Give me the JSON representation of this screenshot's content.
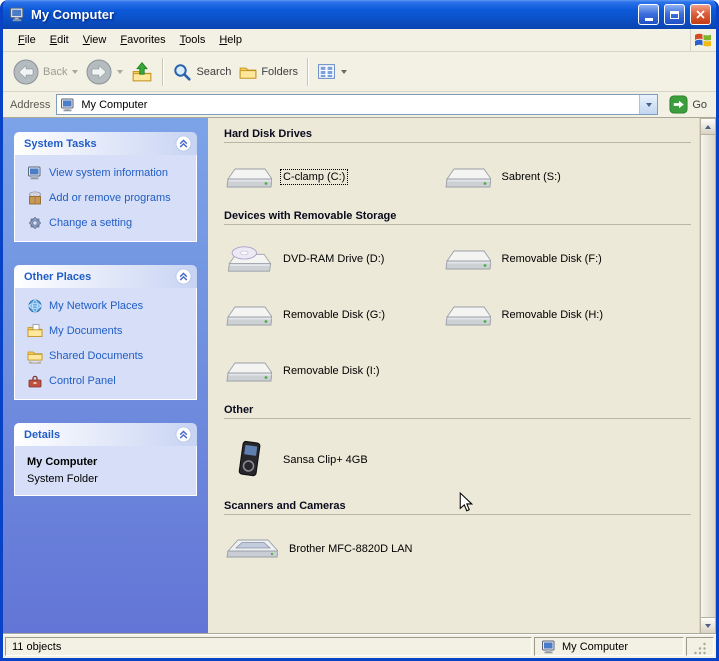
{
  "window": {
    "title": "My Computer"
  },
  "menu": {
    "items": [
      "File",
      "Edit",
      "View",
      "Favorites",
      "Tools",
      "Help"
    ]
  },
  "toolbar": {
    "back_label": "Back",
    "search_label": "Search",
    "folders_label": "Folders"
  },
  "address_bar": {
    "label": "Address",
    "value": "My Computer",
    "go_label": "Go"
  },
  "sidebar": {
    "system_tasks": {
      "title": "System Tasks",
      "items": [
        "View system information",
        "Add or remove programs",
        "Change a setting"
      ]
    },
    "other_places": {
      "title": "Other Places",
      "items": [
        "My Network Places",
        "My Documents",
        "Shared Documents",
        "Control Panel"
      ]
    },
    "details": {
      "title": "Details",
      "name": "My Computer",
      "type": "System Folder"
    }
  },
  "content": {
    "sections": [
      {
        "title": "Hard Disk Drives",
        "items": [
          {
            "label": "C-clamp (C:)"
          },
          {
            "label": "Sabrent (S:)"
          }
        ]
      },
      {
        "title": "Devices with Removable Storage",
        "items": [
          {
            "label": "DVD-RAM Drive (D:)"
          },
          {
            "label": "Removable Disk (F:)"
          },
          {
            "label": "Removable Disk (G:)"
          },
          {
            "label": "Removable Disk (H:)"
          },
          {
            "label": "Removable Disk (I:)"
          }
        ]
      },
      {
        "title": "Other",
        "items": [
          {
            "label": "Sansa Clip+ 4GB"
          }
        ]
      },
      {
        "title": "Scanners and Cameras",
        "items": [
          {
            "label": "Brother MFC-8820D LAN"
          }
        ]
      }
    ]
  },
  "status_bar": {
    "objects": "11 objects",
    "location": "My Computer"
  },
  "colors": {
    "titlebar_blue": "#0A4FC4",
    "sidebar_link": "#215DC6",
    "content_bg": "#ECE9D8",
    "close_red": "#C33C14"
  }
}
